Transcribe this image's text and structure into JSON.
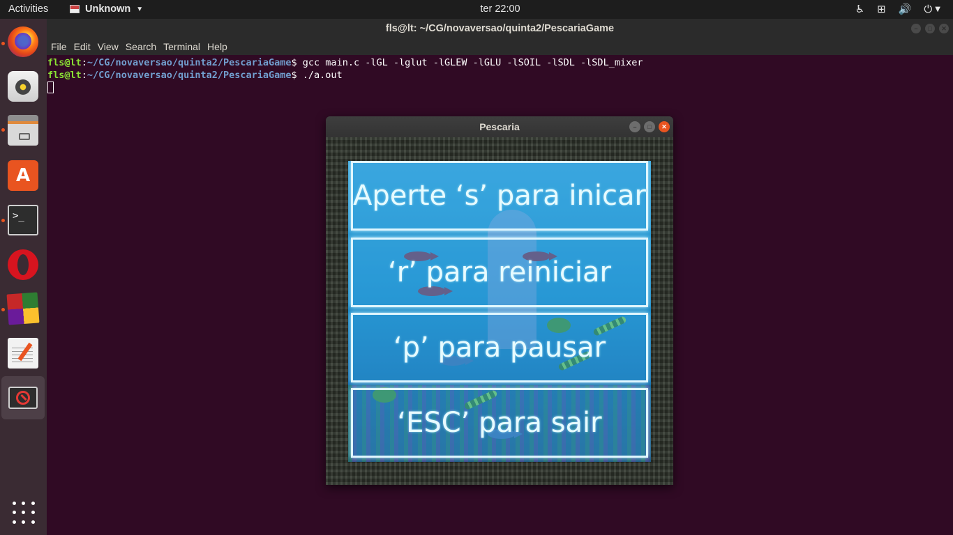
{
  "topbar": {
    "activities": "Activities",
    "app_menu": "Unknown",
    "clock": "ter 22:00"
  },
  "dock": {
    "items": [
      {
        "name": "firefox",
        "running": true
      },
      {
        "name": "rhythmbox",
        "running": false
      },
      {
        "name": "files",
        "running": true
      },
      {
        "name": "ubuntu-software",
        "running": false
      },
      {
        "name": "terminal",
        "running": true
      },
      {
        "name": "opera",
        "running": false
      },
      {
        "name": "wine",
        "running": true
      },
      {
        "name": "text-editor",
        "running": false
      },
      {
        "name": "unknown-app",
        "running": true
      }
    ],
    "software_letter": "A",
    "terminal_glyph": ">_"
  },
  "terminal": {
    "title": "fls@lt: ~/CG/novaversao/quinta2/PescariaGame",
    "menu": [
      "File",
      "Edit",
      "View",
      "Search",
      "Terminal",
      "Help"
    ],
    "lines": [
      {
        "user": "fls@lt",
        "path": "~/CG/novaversao/quinta2/PescariaGame",
        "command": "gcc main.c -lGL -lglut -lGLEW -lGLU -lSOIL -lSDL -lSDL_mixer"
      },
      {
        "user": "fls@lt",
        "path": "~/CG/novaversao/quinta2/PescariaGame",
        "command": "./a.out"
      }
    ]
  },
  "game": {
    "title": "Pescaria",
    "menu": [
      "Aperte ‘s’ para inicar",
      "‘r’ para reiniciar",
      "‘p’ para pausar",
      "‘ESC’ para sair"
    ]
  },
  "colors": {
    "terminal_bg": "#300a24",
    "prompt_user": "#8ae234",
    "prompt_path": "#729fcf",
    "accent": "#e95420"
  }
}
